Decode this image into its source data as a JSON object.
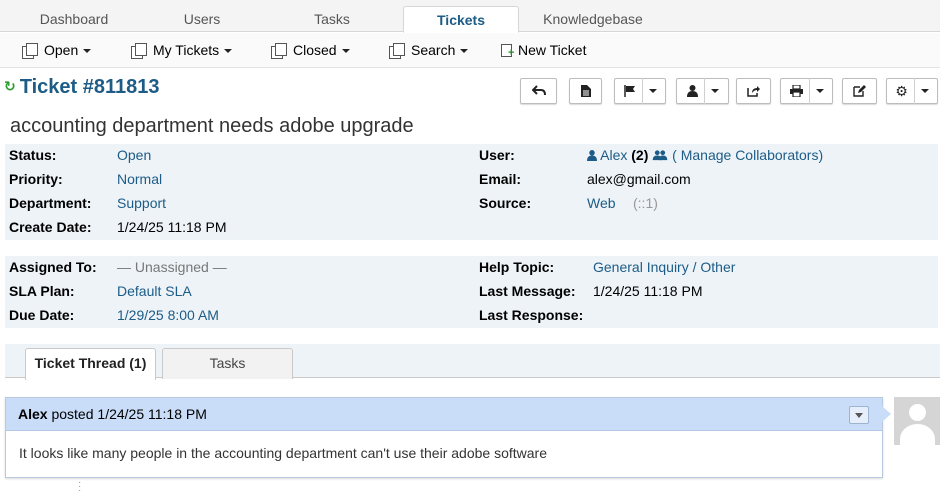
{
  "topnav": {
    "tabs": [
      {
        "label": "Dashboard"
      },
      {
        "label": "Users"
      },
      {
        "label": "Tasks"
      },
      {
        "label": "Tickets"
      },
      {
        "label": "Knowledgebase"
      }
    ],
    "active": "Tickets"
  },
  "subnav": {
    "open": "Open",
    "my_tickets": "My Tickets",
    "closed": "Closed",
    "search": "Search",
    "new_ticket": "New Ticket"
  },
  "ticket": {
    "title": "Ticket #811813",
    "subject": "accounting department needs adobe upgrade"
  },
  "actions": [
    {
      "icon": "reply-icon"
    },
    {
      "icon": "document-icon"
    },
    {
      "icon": "flag-icon"
    },
    {
      "icon": "user-icon"
    },
    {
      "icon": "share-icon"
    },
    {
      "icon": "print-icon"
    },
    {
      "icon": "edit-icon"
    },
    {
      "icon": "gear-icon"
    }
  ],
  "info1": {
    "status_label": "Status:",
    "status": "Open",
    "priority_label": "Priority:",
    "priority": "Normal",
    "department_label": "Department:",
    "department": "Support",
    "create_date_label": "Create Date:",
    "create_date": "1/24/25 11:18 PM",
    "user_label": "User:",
    "user_name": "Alex",
    "user_count": "(2)",
    "manage_collaborators": "( Manage Collaborators)",
    "email_label": "Email:",
    "email": "alex@gmail.com",
    "source_label": "Source:",
    "source": "Web",
    "source_ip": "(::1)"
  },
  "info2": {
    "assigned_label": "Assigned To:",
    "assigned": "— Unassigned —",
    "sla_label": "SLA Plan:",
    "sla": "Default SLA",
    "due_label": "Due Date:",
    "due": "1/29/25 8:00 AM",
    "help_topic_label": "Help Topic:",
    "help_topic": "General Inquiry / Other",
    "last_message_label": "Last Message:",
    "last_message": "1/24/25 11:18 PM",
    "last_response_label": "Last Response:",
    "last_response": ""
  },
  "thread_tabs": {
    "thread": "Ticket Thread (1)",
    "tasks": "Tasks"
  },
  "entry": {
    "author": "Alex",
    "posted": "posted",
    "date": "1/24/25 11:18 PM",
    "body": "It looks like many people in the accounting department can't use their adobe software"
  }
}
